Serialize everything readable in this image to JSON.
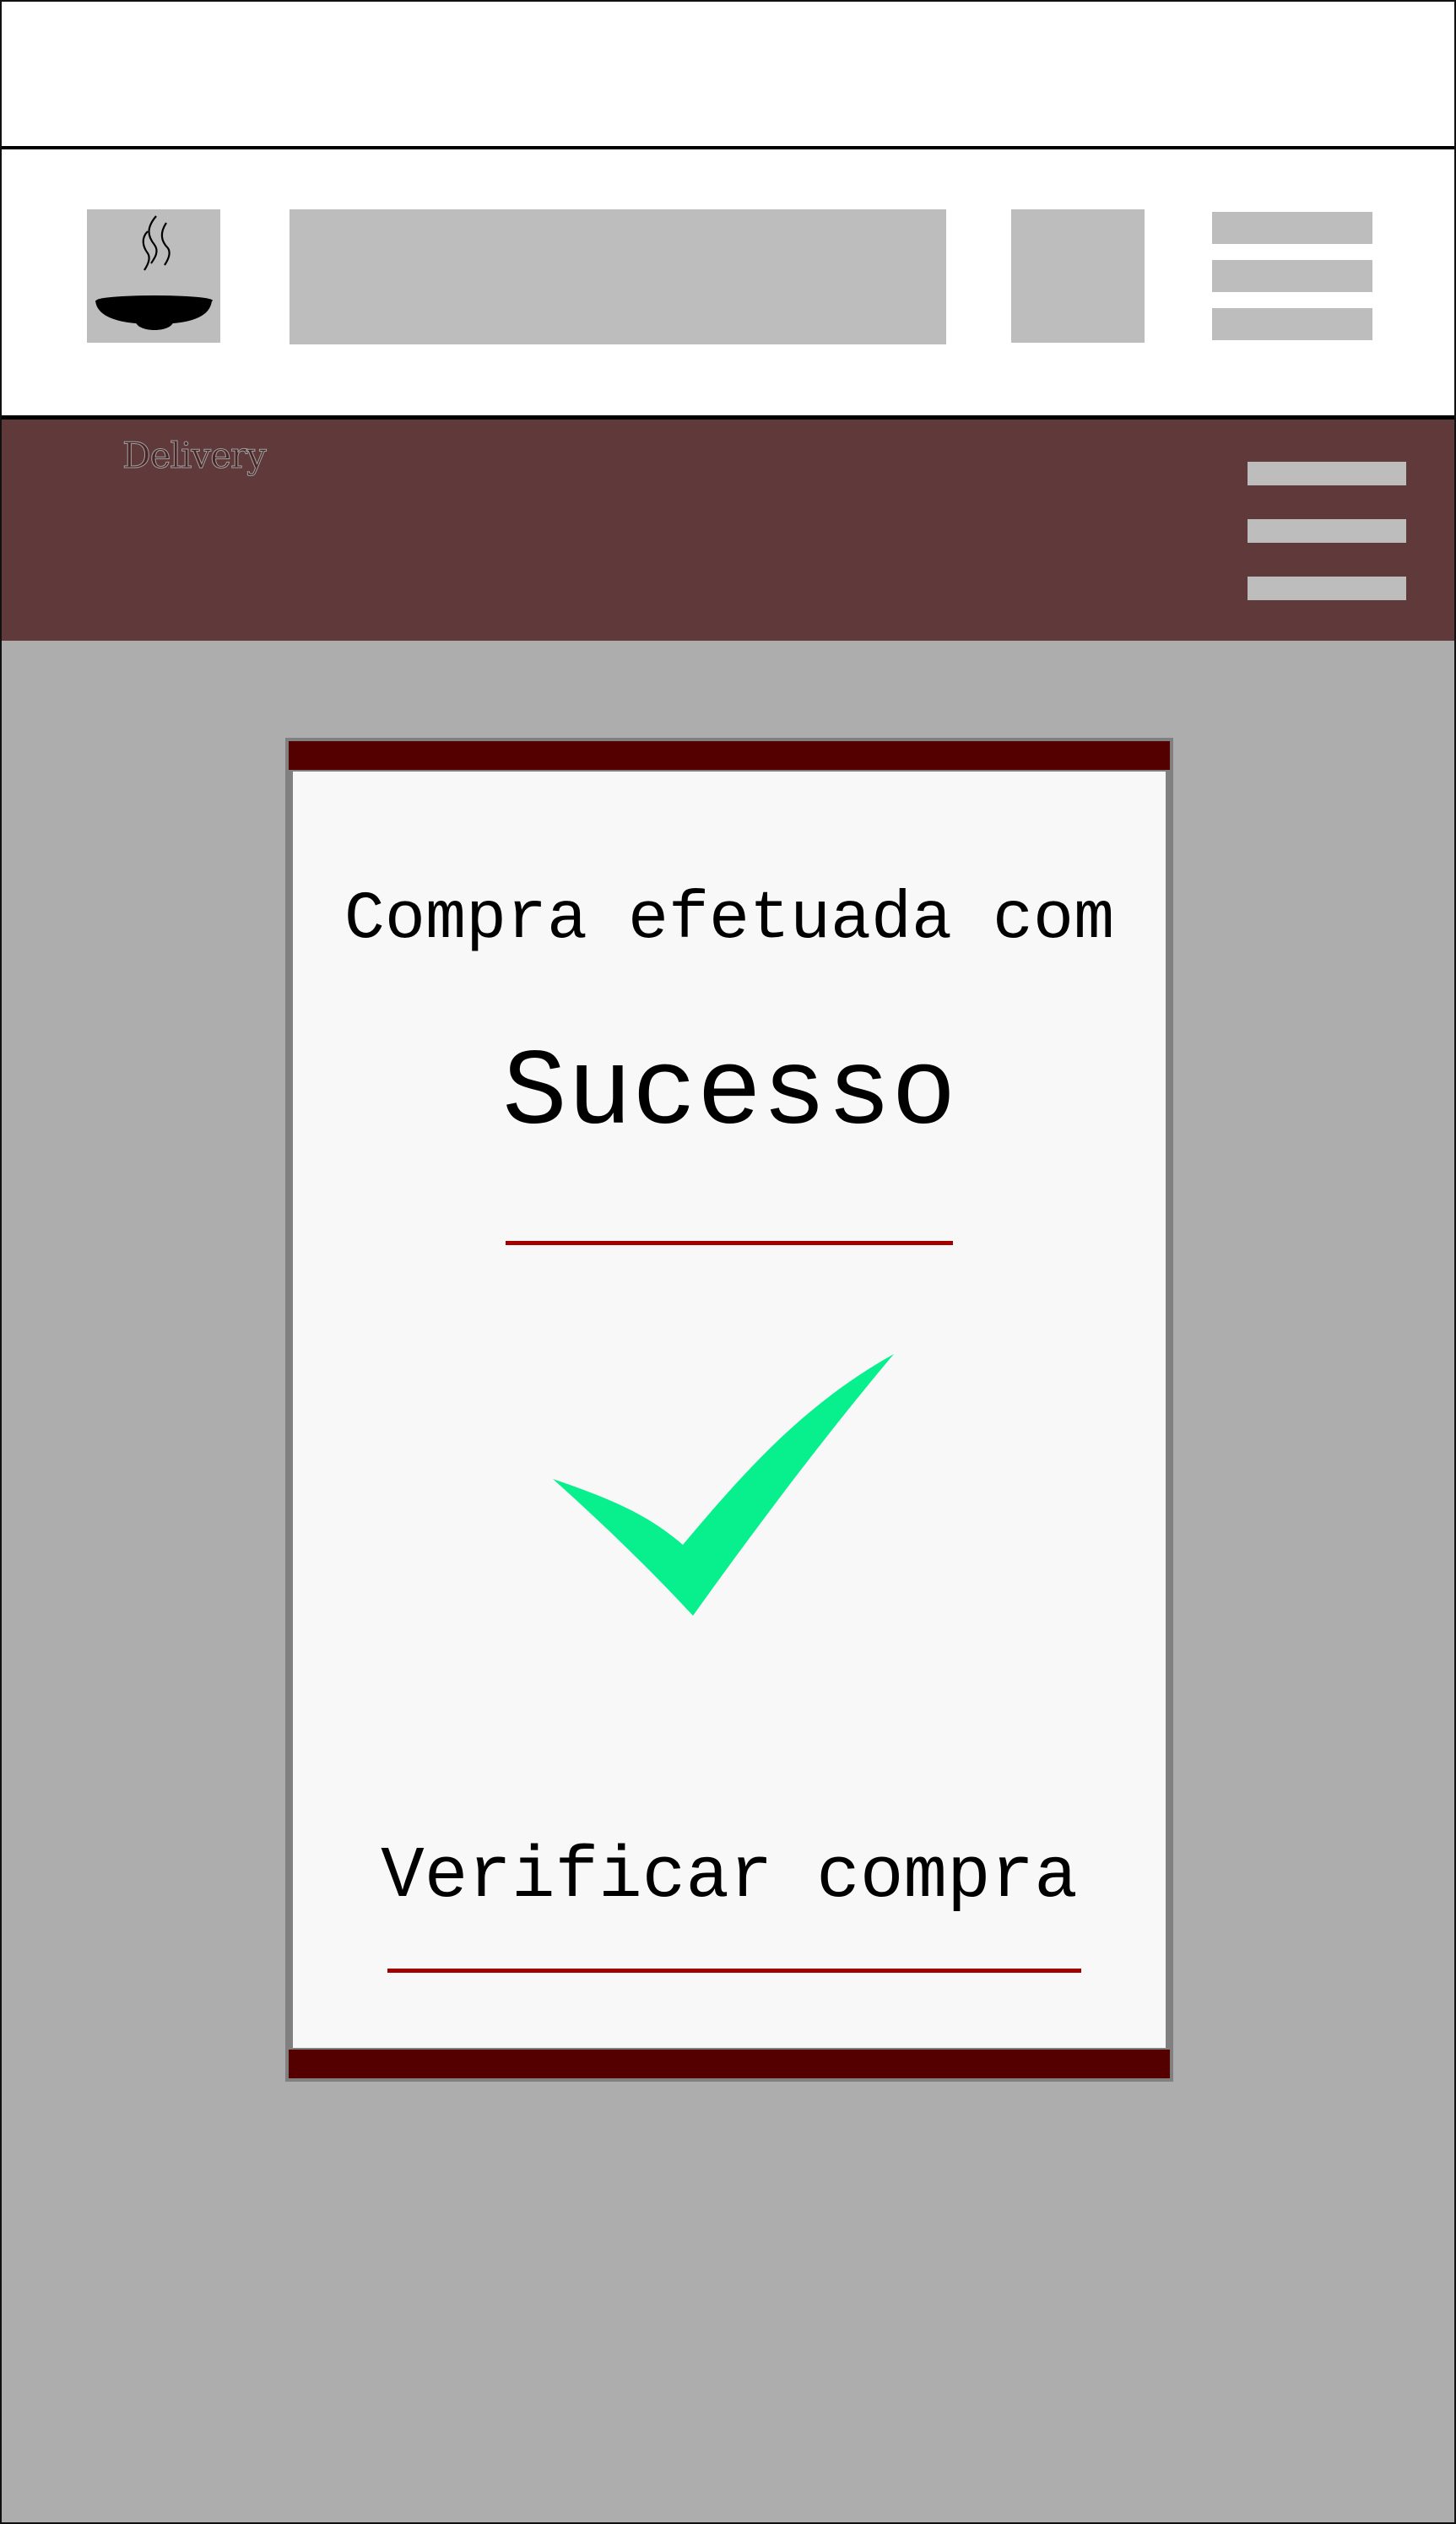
{
  "site": {
    "brand": "Delivery"
  },
  "icons": {
    "logo": "steaming-bowl-icon",
    "browser_menu": "hamburger-menu-icon",
    "site_menu": "hamburger-menu-icon",
    "success": "checkmark-icon"
  },
  "modal": {
    "message_line1": "Compra efetuada com",
    "message_line2": "Sucesso",
    "verify_link": "Verificar compra"
  },
  "colors": {
    "header": "#603a3a",
    "card_bar": "#550000",
    "accent_line": "#a00000",
    "check": "#08f08e",
    "placeholder": "#bdbdbd",
    "background": "#adadad"
  }
}
